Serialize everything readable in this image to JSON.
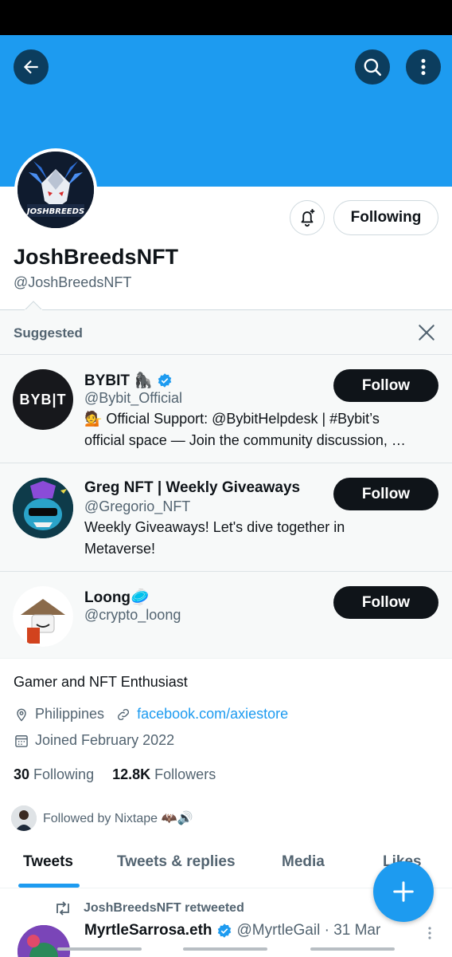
{
  "header": {
    "back_icon": "back-arrow-icon",
    "search_icon": "search-icon",
    "more_icon": "more-vertical-icon",
    "banner_color": "#1d9bf0"
  },
  "profile": {
    "avatar_text": "JOSHBREEDS",
    "display_name": "JoshBreedsNFT",
    "handle": "@JoshBreedsNFT",
    "following_label": "Following",
    "bio": "Gamer and NFT Enthusiast",
    "location": "Philippines",
    "website": "facebook.com/axiestore",
    "joined": "Joined February 2022",
    "following_count": "30",
    "following_label_text": "Following",
    "followers_count": "12.8K",
    "followers_label_text": "Followers",
    "followed_by": "Followed by Nixtape 🦇🔊"
  },
  "suggested": {
    "title": "Suggested",
    "accounts": [
      {
        "name": "BYBIT 🦍",
        "handle": "@Bybit_Official",
        "bio_line1": "💁 Official Support: @BybitHelpdesk | #Bybit’s",
        "bio_line2": "official space — Join the community discussion, …",
        "avatar_text": "BYB|T",
        "button": "Follow",
        "verified": true
      },
      {
        "name": "Greg NFT | Weekly Giveaways",
        "handle": "@Gregorio_NFT",
        "bio_line1": "Weekly Giveaways! Let's dive together in",
        "bio_line2": "Metaverse!",
        "button": "Follow",
        "verified": false
      },
      {
        "name": "Loong🥏",
        "handle": "@crypto_loong",
        "button": "Follow",
        "verified": false
      }
    ]
  },
  "tabs": [
    "Tweets",
    "Tweets & replies",
    "Media",
    "Likes"
  ],
  "tweet": {
    "retweet_text": "JoshBreedsNFT retweeted",
    "author_name": "MyrtleSarrosa.eth",
    "author_handle_date": "@MyrtleGail · 31 Mar"
  },
  "colors": {
    "accent": "#1d9bf0",
    "text_primary": "#0f1419",
    "text_secondary": "#536471"
  }
}
